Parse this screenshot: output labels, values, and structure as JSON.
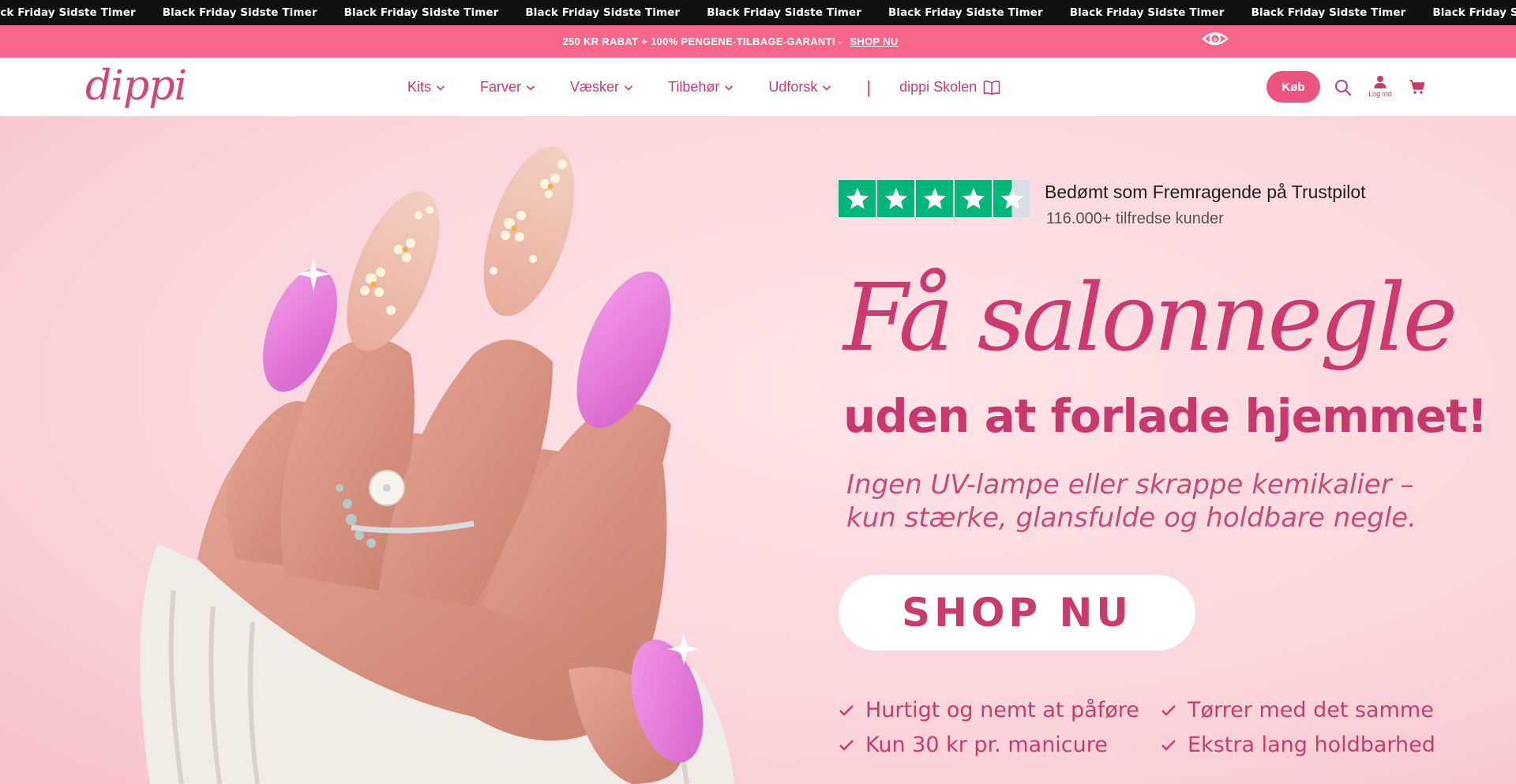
{
  "marquee": {
    "items": [
      "Black Friday Sidste Timer",
      "Black Friday Sidste Timer",
      "Black Friday Sidste Timer",
      "Black Friday Sidste Timer",
      "Black Friday Sidste Timer",
      "Black Friday Sidste Timer",
      "Black Friday Sidste Timer",
      "Black Friday Sidste Timer",
      "Black Friday Sidste Timer",
      "Black Friday Sidste Timer",
      "Black Friday Sidste Timer"
    ]
  },
  "promo": {
    "text": "250 KR RABAT + 100% PENGENE-TILBAGE-GARANTI",
    "separator": "-",
    "link": "SHOP NU"
  },
  "header": {
    "logo": "dippi",
    "nav": [
      {
        "label": "Kits"
      },
      {
        "label": "Farver"
      },
      {
        "label": "Væsker"
      },
      {
        "label": "Tilbehør"
      },
      {
        "label": "Udforsk"
      }
    ],
    "divider": "|",
    "skolen": "dippi Skolen",
    "buy_label": "Køb",
    "login_label": "Log ind"
  },
  "hero": {
    "trustpilot": {
      "title": "Bedømt som Fremragende på Trustpilot",
      "subtitle": "116.000+ tilfredse kunder",
      "stars": 4.5
    },
    "headline_line1": "Få salonnegle",
    "headline_line2": "uden at forlade hjemmet!",
    "subtext": "Ingen UV-lampe eller skrappe kemikalier – kun stærke, glansfulde og holdbare negle.",
    "cta": "SHOP NU",
    "features": [
      "Hurtigt og nemt at påføre",
      "Tørrer med det samme",
      "Kun 30 kr pr. manicure",
      "Ekstra lang holdbarhed"
    ]
  },
  "colors": {
    "brand": "#c93b6d",
    "promo_bg": "#f7658b",
    "trustpilot_green": "#00b67a"
  }
}
